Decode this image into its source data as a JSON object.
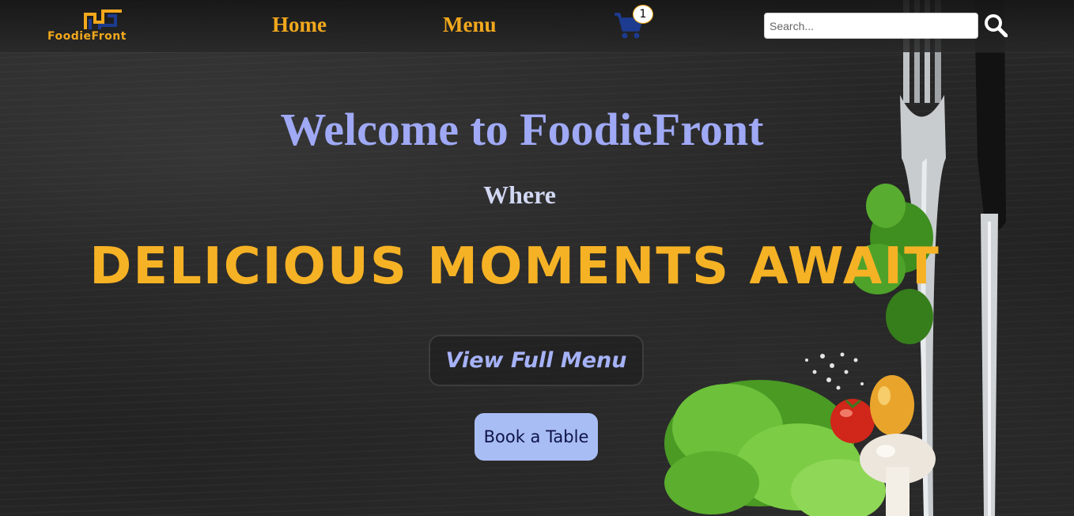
{
  "brand": {
    "name": "FoodieFront",
    "color": "#f2a81d"
  },
  "nav": {
    "items": [
      {
        "label": "Home"
      },
      {
        "label": "Menu"
      }
    ],
    "cart": {
      "icon": "shopping-cart-icon",
      "count": "1",
      "color": "#1d3b8f"
    },
    "search": {
      "placeholder": "Search...",
      "value": "",
      "icon": "search-icon"
    }
  },
  "hero": {
    "title": "Welcome to FoodieFront",
    "subtitle": "Where",
    "tagline": "DELICIOUS MOMENTS AWAIT",
    "primary_button": "View Full Menu",
    "secondary_button": "Book a Table"
  },
  "colors": {
    "accent": "#f6b225",
    "title": "#9fa9f5",
    "button_fill": "#a9bdf5"
  }
}
